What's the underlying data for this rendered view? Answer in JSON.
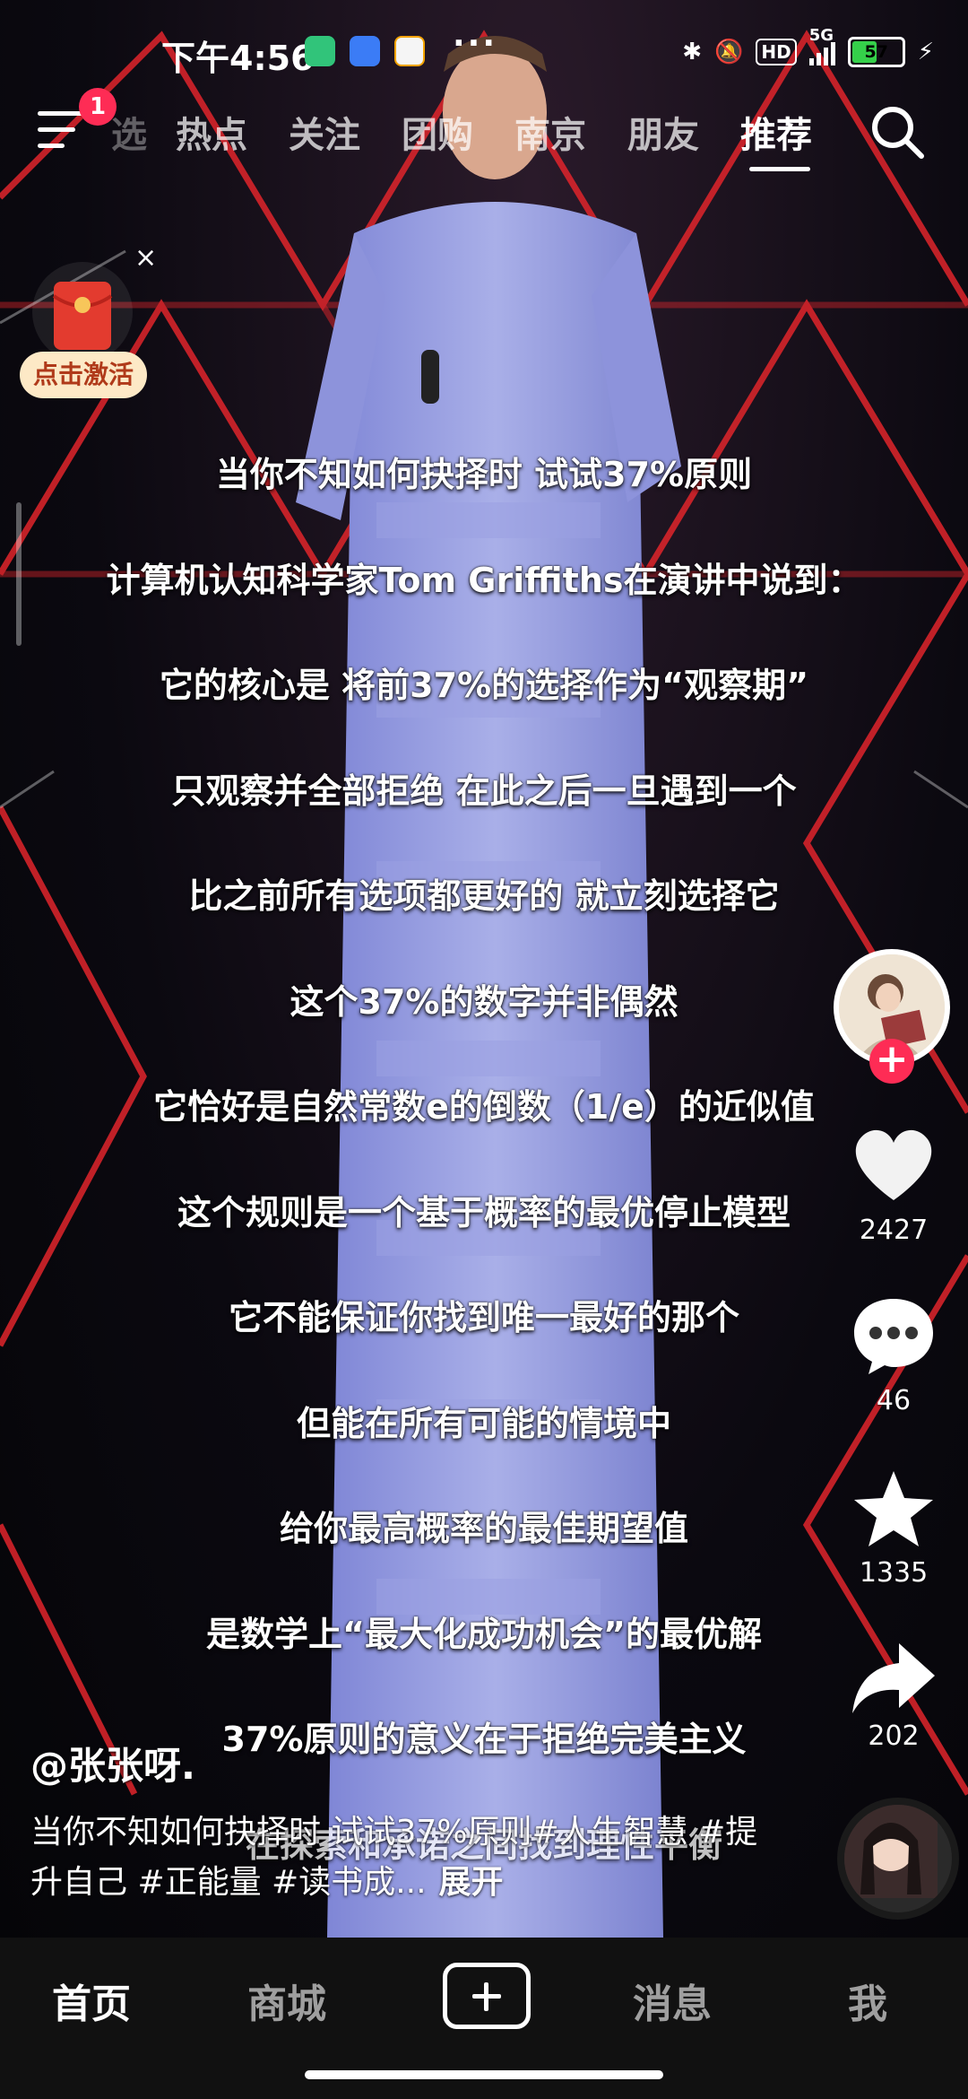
{
  "status_bar": {
    "time": "下午4:56",
    "more": "···",
    "network": "5G",
    "battery": "57",
    "battery_level": 0.57
  },
  "top_nav": {
    "badge": "1",
    "tabs": [
      {
        "label": "选"
      },
      {
        "label": "热点"
      },
      {
        "label": "关注"
      },
      {
        "label": "团购"
      },
      {
        "label": "南京"
      },
      {
        "label": "朋友"
      },
      {
        "label": "推荐",
        "active": true
      }
    ]
  },
  "promo": {
    "close": "×",
    "label": "点击激活"
  },
  "captions": [
    "当你不知如何抉择时 试试37%原则",
    "计算机认知科学家Tom Griffiths在演讲中说到：",
    "它的核心是 将前37%的选择作为“观察期”",
    "只观察并全部拒绝 在此之后一旦遇到一个",
    "比之前所有选项都更好的 就立刻选择它",
    "这个37%的数字并非偶然",
    "它恰好是自然常数e的倒数（1/e）的近似值",
    "这个规则是一个基于概率的最优停止模型",
    "它不能保证你找到唯一最好的那个",
    "但能在所有可能的情境中",
    "给你最高概率的最佳期望值",
    "是数学上“最大化成功机会”的最优解",
    "37%原则的意义在于拒绝完美主义",
    "在探索和承诺之间找到理性平衡"
  ],
  "right_rail": {
    "follow": "+",
    "likes": "2427",
    "comments": "46",
    "favorites": "1335",
    "shares": "202"
  },
  "post": {
    "author": "@张张呀.",
    "description": "当你不知如何抉择时 试试37%原则#人生智慧 #提升自己 #正能量 #读书成...",
    "expand": "展开"
  },
  "bottom_nav": {
    "home": "首页",
    "mall": "商城",
    "messages": "消息",
    "me": "我"
  },
  "colors": {
    "accent": "#fe2c55",
    "promo_bg": "#fde9c6",
    "battery_fill": "#35d04a",
    "stage_red": "#e0252b"
  }
}
